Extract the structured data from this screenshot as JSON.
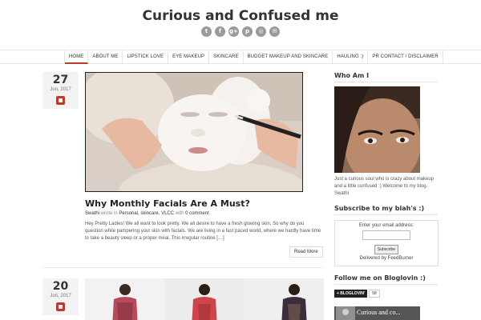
{
  "site": {
    "title": "Curious and Confused me",
    "social_icons": [
      {
        "name": "twitter-icon",
        "glyph": "t"
      },
      {
        "name": "facebook-icon",
        "glyph": "f"
      },
      {
        "name": "google-plus-icon",
        "glyph": "g+"
      },
      {
        "name": "pinterest-icon",
        "glyph": "p"
      },
      {
        "name": "instagram-icon",
        "glyph": "◎"
      },
      {
        "name": "email-icon",
        "glyph": "✉"
      }
    ]
  },
  "nav": {
    "items": [
      {
        "label": "HOME",
        "active": true
      },
      {
        "label": "ABOUT ME",
        "active": false
      },
      {
        "label": "LIPSTICK LOVE",
        "active": false
      },
      {
        "label": "EYE MAKEUP",
        "active": false
      },
      {
        "label": "SKINCARE",
        "active": false
      },
      {
        "label": "BUDGET MAKEUP AND SKINCARE",
        "active": false
      },
      {
        "label": "HAULING :)",
        "active": false
      },
      {
        "label": "PR CONTACT / DISCLAIMER",
        "active": false
      }
    ]
  },
  "posts": [
    {
      "day": "27",
      "month_year": "Jun, 2017",
      "title": "Why Monthly Facials Are A Must?",
      "author": "Swathi",
      "wrote_in": "wrote in",
      "categories": "Personal, skincare, VLCC",
      "with": "with",
      "comments": "0 comment",
      "excerpt": "Hey Pretty Ladies! We all want to look pretty. We all desire to have a fresh glowing skin. So why do you question while pampering your skin with facials. We are living in a fast paced world, where we hardly have time to take a beauty sleep or a proper meal. This irregular routine […]",
      "read_more": "Read More"
    },
    {
      "day": "20",
      "month_year": "Jun, 2017"
    }
  ],
  "sidebar": {
    "who_am_i_title": "Who Am I",
    "about_text": "Just a curious soul who is crazy about makeup and a little confused :) Welcome to my blog. Swathi",
    "subscribe_title": "Subscribe to my blah's :)",
    "email_label": "Enter your email address:",
    "subscribe_button": "Subscribe",
    "delivered_by": "Delivered by FeedBurner",
    "follow_title": "Follow me on Bloglovin :)",
    "bloglovin_button": "+ BLOGLOVIN'",
    "bloglovin_count": "58",
    "mini_post_title": "Curious and co..."
  },
  "colors": {
    "accent": "#c0392b",
    "text": "#333333",
    "border": "#e6e6e6"
  }
}
